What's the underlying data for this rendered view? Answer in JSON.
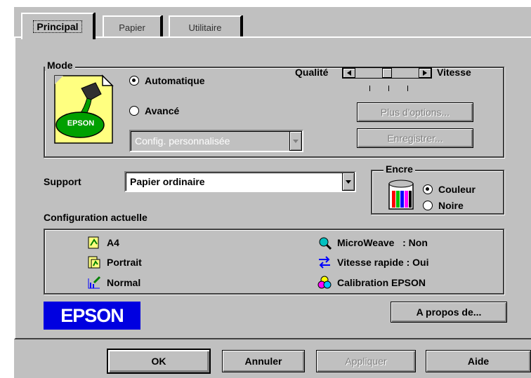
{
  "tabs": [
    {
      "label": "Principal",
      "active": true
    },
    {
      "label": "Papier",
      "active": false
    },
    {
      "label": "Utilitaire",
      "active": false
    }
  ],
  "mode": {
    "group_label": "Mode",
    "icon_label": "EPSON",
    "auto_label": "Automatique",
    "advanced_label": "Avancé",
    "selected": "Automatique",
    "custom_config_value": "Config. personnalisée",
    "quality_label": "Qualité",
    "speed_label": "Vitesse",
    "slider_level_fraction": 0.5,
    "more_options_label": "Plus d'options...",
    "save_label": "Enregistrer..."
  },
  "support": {
    "label": "Support",
    "value": "Papier ordinaire"
  },
  "ink": {
    "group_label": "Encre",
    "color_label": "Couleur",
    "black_label": "Noire",
    "selected": "Couleur"
  },
  "current_config": {
    "label": "Configuration actuelle",
    "left_items": [
      "A4",
      "Portrait",
      "Normal"
    ],
    "right_items": [
      "MicroWeave   : Non",
      "Vitesse rapide : Oui",
      "Calibration EPSON"
    ]
  },
  "brand_logo": "EPSON",
  "about_label": "A propos de...",
  "footer": {
    "ok": "OK",
    "cancel": "Annuler",
    "apply": "Appliquer",
    "help": "Aide"
  },
  "colors": {
    "dialog_bg": "#c0c0c0",
    "epson_blue": "#0000e0",
    "epson_green": "#00a000"
  }
}
